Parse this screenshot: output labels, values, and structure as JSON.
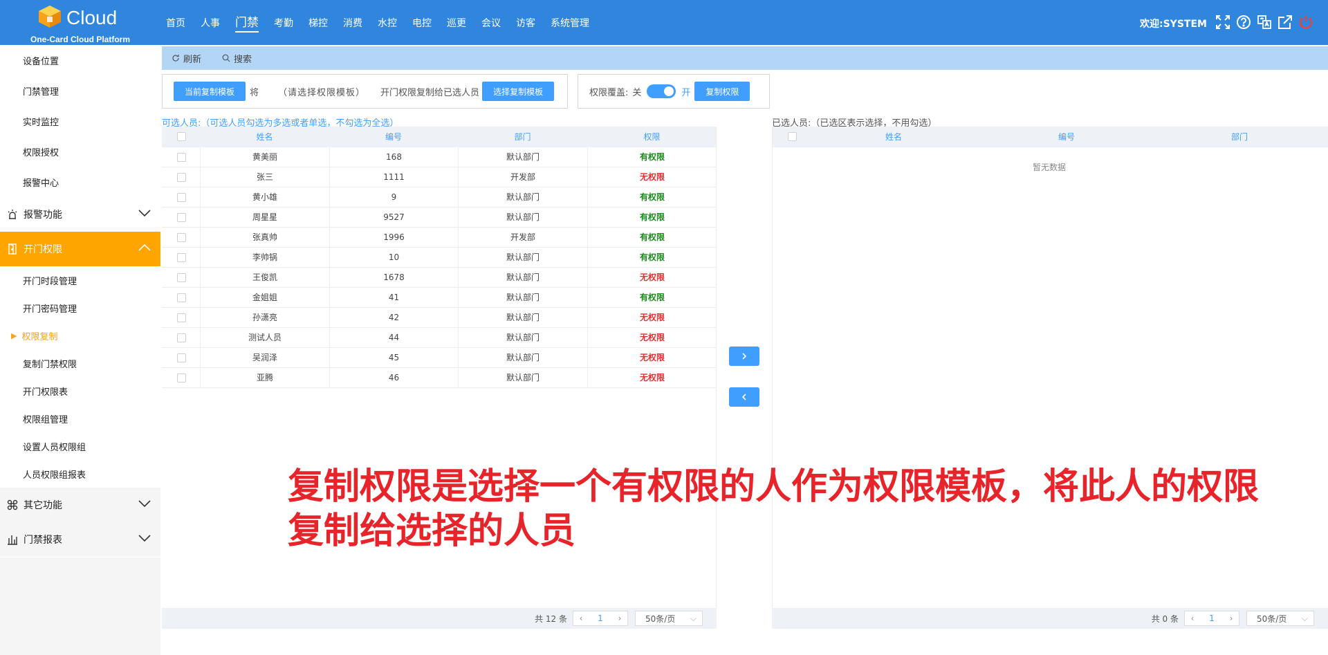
{
  "app": {
    "brand": "Cloud",
    "subtitle": "One-Card Cloud Platform",
    "welcome": "欢迎:SYSTEM",
    "accent": "#2f86dc",
    "button_color": "#409eff",
    "active_color": "#ffa500"
  },
  "nav": [
    "首页",
    "人事",
    "门禁",
    "考勤",
    "梯控",
    "消费",
    "水控",
    "电控",
    "巡更",
    "会议",
    "访客",
    "系统管理"
  ],
  "top_icons": [
    "fullscreen-icon",
    "help-icon",
    "translate-icon",
    "external-link-icon",
    "power-icon"
  ],
  "sidebar": {
    "top_items": [
      "设备位置",
      "门禁管理",
      "实时监控",
      "权限授权",
      "报警中心"
    ],
    "group_alarm": "报警功能",
    "group_open": "开门权限",
    "open_items": [
      "开门时段管理",
      "开门密码管理",
      "权限复制",
      "复制门禁权限",
      "开门权限表",
      "权限组管理",
      "设置人员权限组",
      "人员权限组报表"
    ],
    "group_other": "其它功能",
    "group_report": "门禁报表"
  },
  "toolbar": {
    "refresh": "刷新",
    "search": "搜索"
  },
  "copy_panel": {
    "template_button": "当前复制模板",
    "will": "将",
    "template_hint": "（请选择权限模板）",
    "copy_to": "开门权限复制给已选人员",
    "select_template_button": "选择复制模板",
    "override_label": "权限覆盖:",
    "off": "关",
    "on": "开",
    "override_on": true,
    "copy_button": "复制权限"
  },
  "left_table": {
    "hint": "可选人员:（可选人员勾选为多选或者单选，不勾选为全选）",
    "columns": [
      "姓名",
      "编号",
      "部门",
      "权限"
    ],
    "rows": [
      [
        "黄美丽",
        "168",
        "默认部门",
        "有权限"
      ],
      [
        "张三",
        "1111",
        "开发部",
        "无权限"
      ],
      [
        "黄小雄",
        "9",
        "默认部门",
        "有权限"
      ],
      [
        "周星星",
        "9527",
        "默认部门",
        "有权限"
      ],
      [
        "张真帅",
        "1996",
        "开发部",
        "有权限"
      ],
      [
        "李帅锅",
        "10",
        "默认部门",
        "有权限"
      ],
      [
        "王俊凯",
        "1678",
        "默认部门",
        "无权限"
      ],
      [
        "金姐姐",
        "41",
        "默认部门",
        "有权限"
      ],
      [
        "孙潇亮",
        "42",
        "默认部门",
        "无权限"
      ],
      [
        "测试人员",
        "44",
        "默认部门",
        "无权限"
      ],
      [
        "吴润泽",
        "45",
        "默认部门",
        "无权限"
      ],
      [
        "亚腾",
        "46",
        "默认部门",
        "无权限"
      ]
    ],
    "total": "共 12 条",
    "page": "1",
    "page_size": "50条/页"
  },
  "right_table": {
    "hint": "已选人员:（已选区表示选择，不用勾选）",
    "columns": [
      "姓名",
      "编号",
      "部门"
    ],
    "empty": "暂无数据",
    "total": "共 0 条",
    "page": "1",
    "page_size": "50条/页"
  },
  "overlay": "复制权限是选择一个有权限的人作为权限模板，将此人的权限复制给选择的人员"
}
